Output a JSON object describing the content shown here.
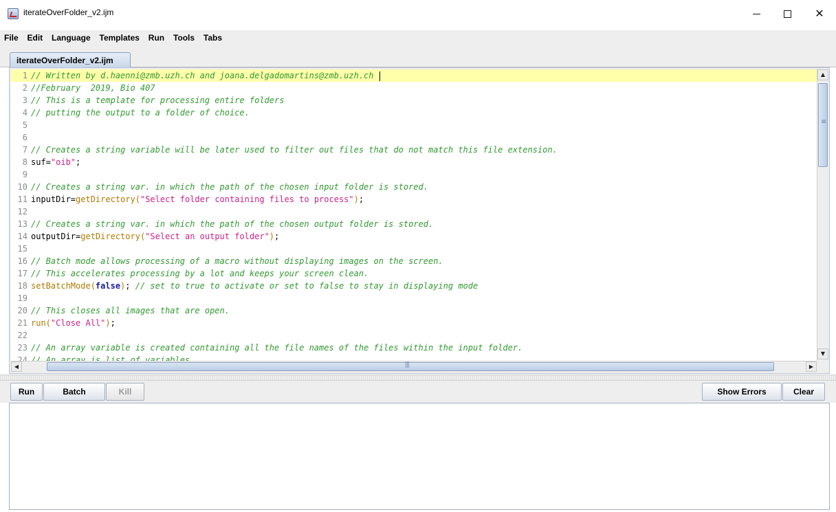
{
  "window": {
    "title": "iterateOverFolder_v2.ijm",
    "minimize": "—",
    "maximize": "☐",
    "close": "✕"
  },
  "menu": [
    {
      "label": "File"
    },
    {
      "label": "Edit"
    },
    {
      "label": "Language"
    },
    {
      "label": "Templates"
    },
    {
      "label": "Run"
    },
    {
      "label": "Tools"
    },
    {
      "label": "Tabs"
    }
  ],
  "tab": {
    "label": "iterateOverFolder_v2.ijm"
  },
  "editor": {
    "lines": [
      {
        "n": "1",
        "current": true,
        "tokens": [
          {
            "t": "comment",
            "v": "// Written by d.haenni@zmb.uzh.ch and joana.delgadomartins@zmb.uzh.ch"
          }
        ]
      },
      {
        "n": "2",
        "tokens": [
          {
            "t": "comment",
            "v": "//February  2019, Bio 407"
          }
        ]
      },
      {
        "n": "3",
        "tokens": [
          {
            "t": "comment",
            "v": "// This is a template for processing entire folders"
          }
        ]
      },
      {
        "n": "4",
        "tokens": [
          {
            "t": "comment",
            "v": "// putting the output to a folder of choice."
          }
        ]
      },
      {
        "n": "5",
        "tokens": []
      },
      {
        "n": "6",
        "tokens": []
      },
      {
        "n": "7",
        "tokens": [
          {
            "t": "comment",
            "v": "// Creates a string variable will be later used to filter out files that do not match this file extension."
          }
        ]
      },
      {
        "n": "8",
        "tokens": [
          {
            "t": "plain",
            "v": "suf="
          },
          {
            "t": "string",
            "v": "\"oib\""
          },
          {
            "t": "plain",
            "v": ";"
          }
        ]
      },
      {
        "n": "9",
        "tokens": []
      },
      {
        "n": "10",
        "tokens": [
          {
            "t": "comment",
            "v": "// Creates a string var. in which the path of the chosen input folder is stored."
          }
        ]
      },
      {
        "n": "11",
        "tokens": [
          {
            "t": "plain",
            "v": "inputDir="
          },
          {
            "t": "func",
            "v": "getDirectory("
          },
          {
            "t": "string",
            "v": "\"Select folder containing files to process\""
          },
          {
            "t": "func",
            "v": ")"
          },
          {
            "t": "plain",
            "v": ";"
          }
        ]
      },
      {
        "n": "12",
        "tokens": []
      },
      {
        "n": "13",
        "tokens": [
          {
            "t": "comment",
            "v": "// Creates a string var. in which the path of the chosen output folder is stored."
          }
        ]
      },
      {
        "n": "14",
        "tokens": [
          {
            "t": "plain",
            "v": "outputDir="
          },
          {
            "t": "func",
            "v": "getDirectory("
          },
          {
            "t": "string",
            "v": "\"Select an output folder\""
          },
          {
            "t": "func",
            "v": ")"
          },
          {
            "t": "plain",
            "v": ";"
          }
        ]
      },
      {
        "n": "15",
        "tokens": []
      },
      {
        "n": "16",
        "tokens": [
          {
            "t": "comment",
            "v": "// Batch mode allows processing of a macro without displaying images on the screen."
          }
        ]
      },
      {
        "n": "17",
        "tokens": [
          {
            "t": "comment",
            "v": "// This accelerates processing by a lot and keeps your screen clean."
          }
        ]
      },
      {
        "n": "18",
        "tokens": [
          {
            "t": "func",
            "v": "setBatchMode("
          },
          {
            "t": "kw",
            "v": "false"
          },
          {
            "t": "func",
            "v": ")"
          },
          {
            "t": "plain",
            "v": "; "
          },
          {
            "t": "comment",
            "v": "// set to true to activate or set to false to stay in displaying mode"
          }
        ]
      },
      {
        "n": "19",
        "tokens": []
      },
      {
        "n": "20",
        "tokens": [
          {
            "t": "comment",
            "v": "// This closes all images that are open."
          }
        ]
      },
      {
        "n": "21",
        "tokens": [
          {
            "t": "func",
            "v": "run("
          },
          {
            "t": "string",
            "v": "\"Close All\""
          },
          {
            "t": "func",
            "v": ")"
          },
          {
            "t": "plain",
            "v": ";"
          }
        ]
      },
      {
        "n": "22",
        "tokens": []
      },
      {
        "n": "23",
        "tokens": [
          {
            "t": "comment",
            "v": "// An array variable is created containing all the file names of the files within the input folder."
          }
        ]
      },
      {
        "n": "24",
        "tokens": [
          {
            "t": "comment",
            "v": "// An array is list of variables."
          }
        ]
      }
    ]
  },
  "buttons": {
    "run": "Run",
    "batch": "Batch",
    "kill": "Kill",
    "show_errors": "Show Errors",
    "clear": "Clear"
  },
  "colors": {
    "comment": "#339933",
    "string": "#cc2288",
    "function": "#b07a00",
    "keyword": "#1a1aa6",
    "current_line": "#ffffaa"
  }
}
